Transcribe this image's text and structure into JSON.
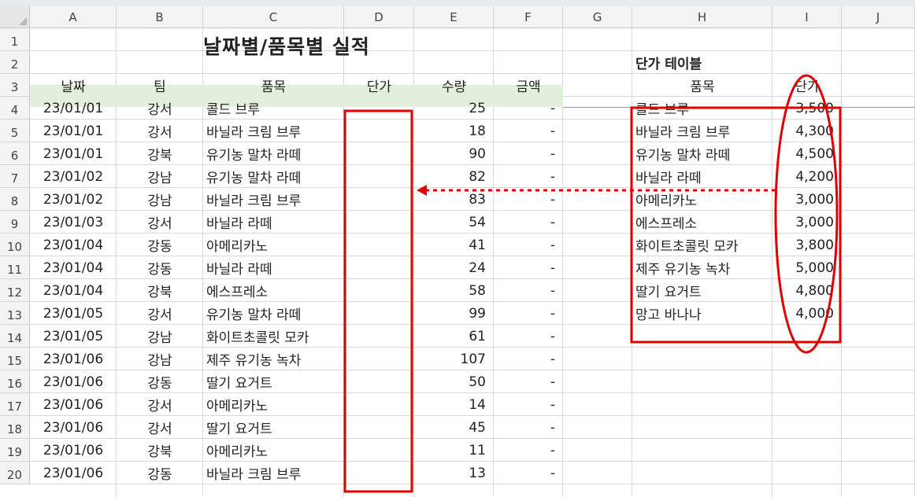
{
  "sheet": {
    "title": "날짜별/품목별 실적",
    "columns": [
      "A",
      "B",
      "C",
      "D",
      "E",
      "F",
      "G",
      "H",
      "I",
      "J"
    ],
    "row_numbers": [
      "1",
      "2",
      "3",
      "4",
      "5",
      "6",
      "7",
      "8",
      "9",
      "10",
      "11",
      "12",
      "13",
      "14",
      "15",
      "16",
      "17",
      "18",
      "19",
      "20"
    ],
    "headers": {
      "date": "날짜",
      "team": "팀",
      "item": "품목",
      "price": "단가",
      "qty": "수량",
      "amount": "금액"
    },
    "rows": [
      {
        "date": "23/01/01",
        "team": "강서",
        "item": "콜드 브루",
        "qty": "25",
        "amount": "-"
      },
      {
        "date": "23/01/01",
        "team": "강서",
        "item": "바닐라 크림 브루",
        "qty": "18",
        "amount": "-"
      },
      {
        "date": "23/01/01",
        "team": "강북",
        "item": "유기농 말차 라떼",
        "qty": "90",
        "amount": "-"
      },
      {
        "date": "23/01/02",
        "team": "강남",
        "item": "유기농 말차 라떼",
        "qty": "82",
        "amount": "-"
      },
      {
        "date": "23/01/02",
        "team": "강남",
        "item": "바닐라 크림 브루",
        "qty": "83",
        "amount": "-"
      },
      {
        "date": "23/01/03",
        "team": "강서",
        "item": "바닐라 라떼",
        "qty": "54",
        "amount": "-"
      },
      {
        "date": "23/01/04",
        "team": "강동",
        "item": "아메리카노",
        "qty": "41",
        "amount": "-"
      },
      {
        "date": "23/01/04",
        "team": "강동",
        "item": "바닐라 라떼",
        "qty": "24",
        "amount": "-"
      },
      {
        "date": "23/01/04",
        "team": "강북",
        "item": "에스프레소",
        "qty": "58",
        "amount": "-"
      },
      {
        "date": "23/01/05",
        "team": "강서",
        "item": "유기농 말차 라떼",
        "qty": "99",
        "amount": "-"
      },
      {
        "date": "23/01/05",
        "team": "강남",
        "item": "화이트초콜릿 모카",
        "qty": "61",
        "amount": "-"
      },
      {
        "date": "23/01/06",
        "team": "강남",
        "item": "제주 유기농 녹차",
        "qty": "107",
        "amount": "-"
      },
      {
        "date": "23/01/06",
        "team": "강동",
        "item": "딸기 요거트",
        "qty": "50",
        "amount": "-"
      },
      {
        "date": "23/01/06",
        "team": "강서",
        "item": "아메리카노",
        "qty": "14",
        "amount": "-"
      },
      {
        "date": "23/01/06",
        "team": "강서",
        "item": "딸기 요거트",
        "qty": "45",
        "amount": "-"
      },
      {
        "date": "23/01/06",
        "team": "강북",
        "item": "아메리카노",
        "qty": "11",
        "amount": "-"
      },
      {
        "date": "23/01/06",
        "team": "강동",
        "item": "바닐라 크림 브루",
        "qty": "13",
        "amount": "-"
      }
    ],
    "price_table": {
      "title": "단가 테이블",
      "header_item": "품목",
      "header_price": "단가",
      "rows": [
        {
          "item": "콜드 브루",
          "price": "3,500"
        },
        {
          "item": "바닐라 크림 브루",
          "price": "4,300"
        },
        {
          "item": "유기농 말차 라떼",
          "price": "4,500"
        },
        {
          "item": "바닐라 라떼",
          "price": "4,200"
        },
        {
          "item": "아메리카노",
          "price": "3,000"
        },
        {
          "item": "에스프레소",
          "price": "3,000"
        },
        {
          "item": "화이트초콜릿 모카",
          "price": "3,800"
        },
        {
          "item": "제주 유기농 녹차",
          "price": "5,000"
        },
        {
          "item": "딸기 요거트",
          "price": "4,800"
        },
        {
          "item": "망고 바나나",
          "price": "4,000"
        }
      ]
    }
  },
  "annotations": {
    "color": "#e00000"
  }
}
